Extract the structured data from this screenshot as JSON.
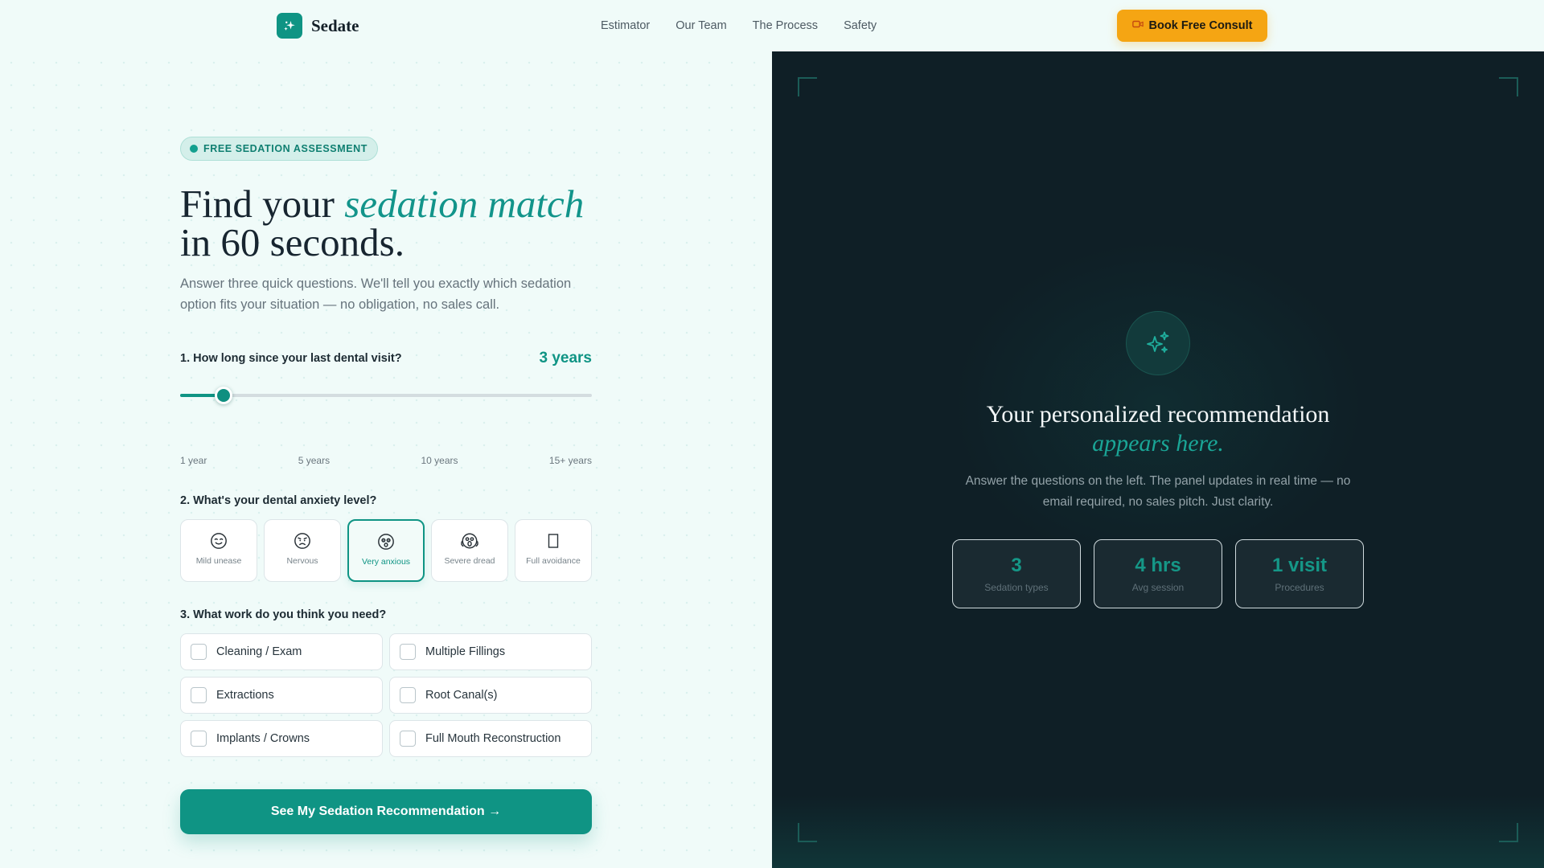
{
  "brand": {
    "name": "Sedate",
    "icon": "sparkle-icon"
  },
  "nav": {
    "items": [
      {
        "label": "Estimator"
      },
      {
        "label": "Our Team"
      },
      {
        "label": "The Process"
      },
      {
        "label": "Safety"
      }
    ],
    "cta_label": "Book Free Consult",
    "cta_icon": "video-camera-icon"
  },
  "hero": {
    "badge": "FREE SEDATION ASSESSMENT",
    "headline_prefix": "Find your ",
    "headline_em": "sedation match",
    "headline_suffix": "in 60 seconds.",
    "lede": "Answer three quick questions. We'll tell you exactly which sedation option fits your situation — no obligation, no sales call."
  },
  "q1": {
    "label": "1. How long since your last dental visit?",
    "value_label": "3 years",
    "value": 3,
    "min": 1,
    "max": 20,
    "ticks": [
      "1 year",
      "5 years",
      "10 years",
      "15+ years"
    ]
  },
  "q2": {
    "label": "2. What's your dental anxiety level?",
    "options": [
      {
        "label": "Mild unease",
        "icon": "relieved-face-icon",
        "selected": false
      },
      {
        "label": "Nervous",
        "icon": "worried-face-icon",
        "selected": false
      },
      {
        "label": "Very anxious",
        "icon": "anxious-face-icon",
        "selected": true
      },
      {
        "label": "Severe dread",
        "icon": "screaming-face-icon",
        "selected": false
      },
      {
        "label": "Full avoidance",
        "icon": "missing-glyph-icon",
        "selected": false
      }
    ]
  },
  "q3": {
    "label": "3. What work do you think you need?",
    "options": [
      {
        "label": "Cleaning / Exam",
        "checked": false
      },
      {
        "label": "Multiple Fillings",
        "checked": false
      },
      {
        "label": "Extractions",
        "checked": false
      },
      {
        "label": "Root Canal(s)",
        "checked": false
      },
      {
        "label": "Implants / Crowns",
        "checked": false
      },
      {
        "label": "Full Mouth Reconstruction",
        "checked": false
      }
    ]
  },
  "submit_label": "See My Sedation Recommendation →",
  "panel": {
    "icon": "sparkles-icon",
    "title": "Your personalized recommendation",
    "title_em": "appears here.",
    "body": "Answer the questions on the left. The panel updates in real time — no email required, no sales pitch. Just clarity.",
    "stats": [
      {
        "value": "3",
        "label": "Sedation types"
      },
      {
        "value": "4 hrs",
        "label": "Avg session"
      },
      {
        "value": "1 visit",
        "label": "Procedures"
      }
    ]
  },
  "colors": {
    "accent": "#0f9484",
    "cta": "#f5a513",
    "panel_bg": "#0f1f26",
    "page_bg": "#f0fbf9"
  }
}
